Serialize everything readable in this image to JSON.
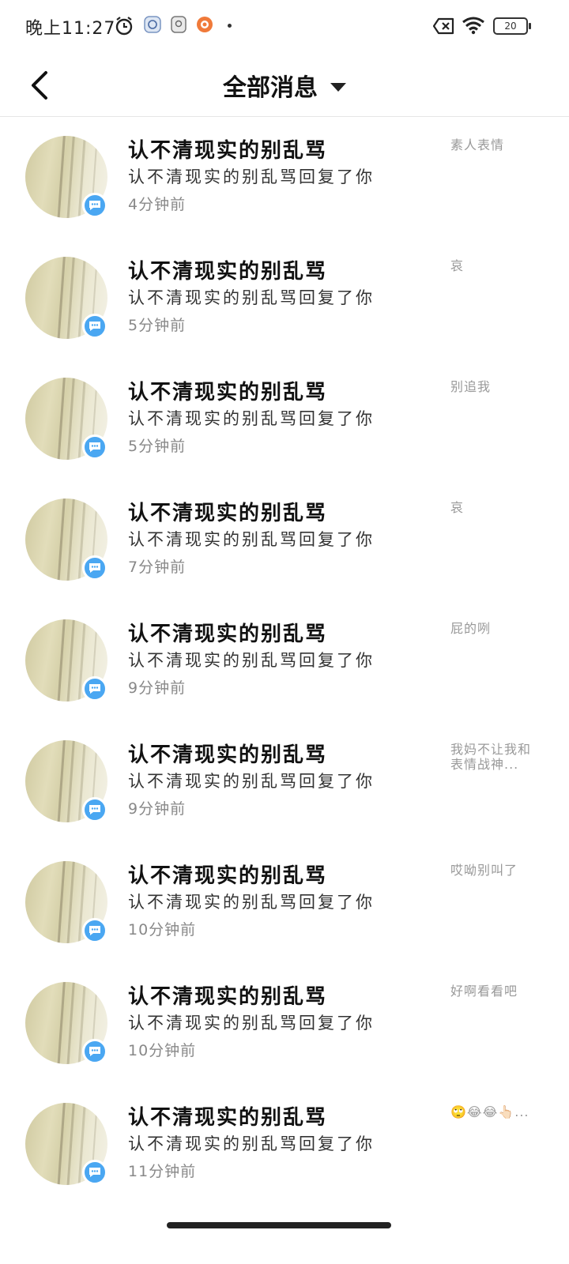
{
  "status_bar": {
    "time": "晚上11:27",
    "battery": "20",
    "icons": [
      "alarm-clock-icon",
      "app-icon-1",
      "app-icon-2",
      "app-icon-3",
      "no-sim-icon",
      "wifi-icon",
      "battery-icon"
    ]
  },
  "header": {
    "back_icon": "back-arrow-icon",
    "title": "全部消息",
    "caret_icon": "caret-down-icon"
  },
  "colors": {
    "badge": "#4aa7f2",
    "divider": "#e6e6e6",
    "preview_text": "#999999"
  },
  "messages": [
    {
      "name": "认不清现实的别乱骂",
      "summary": "认不清现实的别乱骂回复了你",
      "time": "4分钟前",
      "preview": "素人表情"
    },
    {
      "name": "认不清现实的别乱骂",
      "summary": "认不清现实的别乱骂回复了你",
      "time": "5分钟前",
      "preview": "哀"
    },
    {
      "name": "认不清现实的别乱骂",
      "summary": "认不清现实的别乱骂回复了你",
      "time": "5分钟前",
      "preview": "别追我"
    },
    {
      "name": "认不清现实的别乱骂",
      "summary": "认不清现实的别乱骂回复了你",
      "time": "7分钟前",
      "preview": "哀"
    },
    {
      "name": "认不清现实的别乱骂",
      "summary": "认不清现实的别乱骂回复了你",
      "time": "9分钟前",
      "preview": "屁的咧"
    },
    {
      "name": "认不清现实的别乱骂",
      "summary": "认不清现实的别乱骂回复了你",
      "time": "9分钟前",
      "preview": "我妈不让我和表情战神..."
    },
    {
      "name": "认不清现实的别乱骂",
      "summary": "认不清现实的别乱骂回复了你",
      "time": "10分钟前",
      "preview": "哎呦别叫了"
    },
    {
      "name": "认不清现实的别乱骂",
      "summary": "认不清现实的别乱骂回复了你",
      "time": "10分钟前",
      "preview": "好啊看看吧"
    },
    {
      "name": "认不清现实的别乱骂",
      "summary": "认不清现实的别乱骂回复了你",
      "time": "11分钟前",
      "preview": "🙄😂😂👆🏻..."
    }
  ]
}
